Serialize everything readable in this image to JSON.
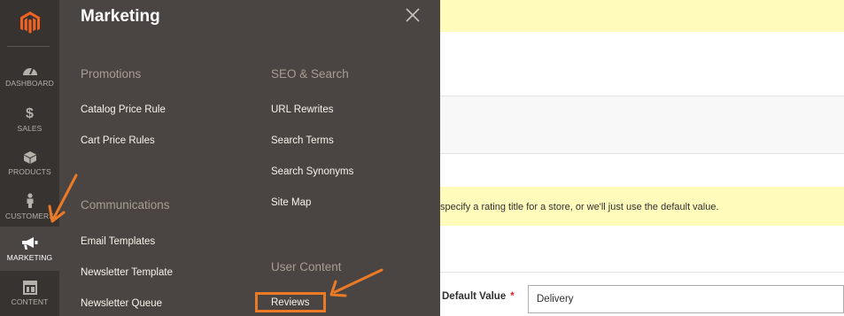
{
  "sidebar": {
    "items": [
      {
        "label": "DASHBOARD",
        "icon": "dashboard-icon"
      },
      {
        "label": "SALES",
        "icon": "dollar-icon"
      },
      {
        "label": "PRODUCTS",
        "icon": "box-icon"
      },
      {
        "label": "CUSTOMERS",
        "icon": "person-icon"
      },
      {
        "label": "MARKETING",
        "icon": "megaphone-icon"
      },
      {
        "label": "CONTENT",
        "icon": "layout-icon"
      }
    ],
    "active": "MARKETING"
  },
  "menu": {
    "title": "Marketing",
    "sections": {
      "promotions": {
        "title": "Promotions",
        "links": [
          "Catalog Price Rule",
          "Cart Price Rules"
        ]
      },
      "communications": {
        "title": "Communications",
        "links": [
          "Email Templates",
          "Newsletter Template",
          "Newsletter Queue"
        ]
      },
      "seo": {
        "title": "SEO & Search",
        "links": [
          "URL Rewrites",
          "Search Terms",
          "Search Synonyms",
          "Site Map"
        ]
      },
      "user_content": {
        "title": "User Content",
        "links": [
          "Reviews"
        ]
      }
    }
  },
  "background": {
    "notice_text": "specify a rating title for a store, or we'll just use the default value.",
    "default_value_label": "Default Value",
    "required_mark": "*",
    "default_value": "Delivery"
  },
  "colors": {
    "accent": "#eb7a26",
    "menu_bg": "#4a4542",
    "sidebar_bg": "#373330",
    "notice_bg": "#fffbbb"
  }
}
